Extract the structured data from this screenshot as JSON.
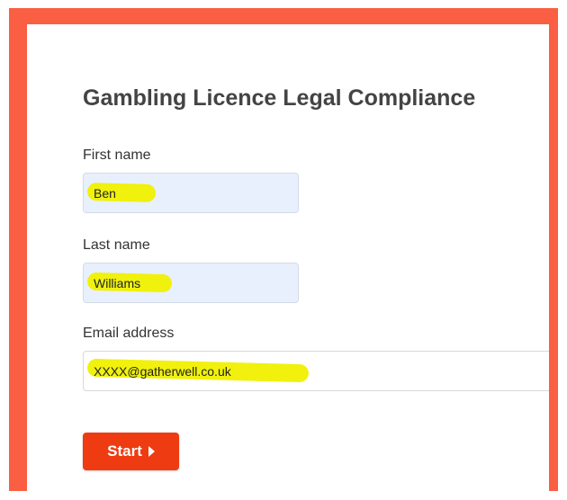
{
  "form": {
    "title": "Gambling Licence Legal Compliance",
    "first_name": {
      "label": "First name",
      "value": "Ben"
    },
    "last_name": {
      "label": "Last name",
      "value": "Williams"
    },
    "email": {
      "label": "Email address",
      "value": "XXXX@gatherwell.co.uk"
    },
    "start_label": "Start",
    "start_icon": "caret-right-icon"
  },
  "colors": {
    "frame": "#fa5f43",
    "button": "#ee3b12",
    "autofill_field": "#e8f0fe",
    "highlight": "#f0f000",
    "title_text": "#444444"
  }
}
